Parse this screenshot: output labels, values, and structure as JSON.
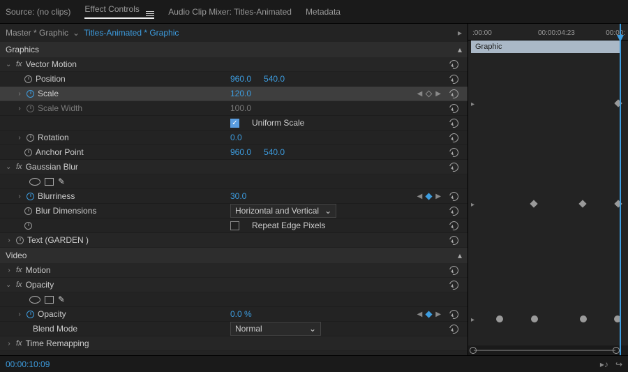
{
  "tabs": {
    "source": "Source: (no clips)",
    "effect_controls": "Effect Controls",
    "audio_mixer": "Audio Clip Mixer: Titles-Animated",
    "metadata": "Metadata"
  },
  "breadcrumb": {
    "master": "Master * Graphic",
    "clip": "Titles-Animated * Graphic"
  },
  "sections": {
    "graphics": "Graphics",
    "video": "Video"
  },
  "effects": {
    "vector_motion": {
      "name": "Vector Motion",
      "position": {
        "label": "Position",
        "x": "960.0",
        "y": "540.0"
      },
      "scale": {
        "label": "Scale",
        "value": "120.0"
      },
      "scale_width": {
        "label": "Scale Width",
        "value": "100.0"
      },
      "uniform_scale": {
        "label": "Uniform Scale",
        "checked": true
      },
      "rotation": {
        "label": "Rotation",
        "value": "0.0"
      },
      "anchor": {
        "label": "Anchor Point",
        "x": "960.0",
        "y": "540.0"
      }
    },
    "gaussian_blur": {
      "name": "Gaussian Blur",
      "blurriness": {
        "label": "Blurriness",
        "value": "30.0"
      },
      "dimensions": {
        "label": "Blur Dimensions",
        "value": "Horizontal and Vertical"
      },
      "repeat_edge": {
        "label": "Repeat Edge Pixels",
        "checked": false
      }
    },
    "text": {
      "name": "Text (GARDEN )"
    },
    "motion": {
      "name": "Motion"
    },
    "opacity": {
      "name": "Opacity",
      "opacity_prop": {
        "label": "Opacity",
        "value": "0.0 %"
      },
      "blend_mode": {
        "label": "Blend Mode",
        "value": "Normal"
      }
    },
    "time_remapping": {
      "name": "Time Remapping"
    }
  },
  "timeline": {
    "t0": ":00:00",
    "t1": "00:00:04:23",
    "t2": "00:00:",
    "clip_label": "Graphic"
  },
  "footer": {
    "timecode": "00:00:10:09"
  }
}
